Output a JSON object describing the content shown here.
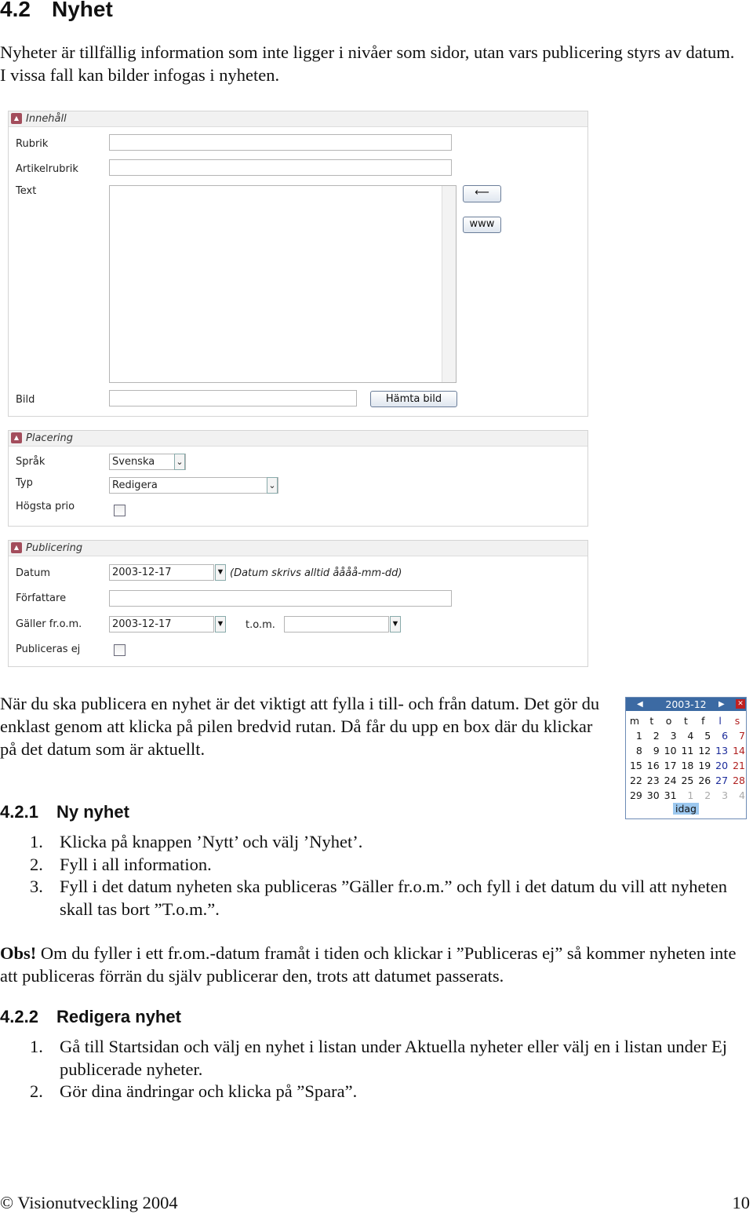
{
  "heading": {
    "number": "4.2",
    "title": "Nyhet"
  },
  "intro": "Nyheter är tillfällig information som inte ligger i nivåer som sidor, utan vars publicering styrs av datum. I vissa fall kan bilder infogas i nyheten.",
  "form": {
    "innehall": {
      "title": "Innehåll",
      "rubrik": "Rubrik",
      "artikelrubrik": "Artikelrubrik",
      "text": "Text",
      "bild": "Bild",
      "hamta_bild": "Hämta bild",
      "www": "www"
    },
    "placering": {
      "title": "Placering",
      "sprak": "Språk",
      "sprak_value": "Svenska",
      "typ": "Typ",
      "typ_value": "Redigera",
      "hogsta_prio": "Högsta prio"
    },
    "publicering": {
      "title": "Publicering",
      "datum": "Datum",
      "datum_value": "2003-12-17",
      "datum_hint": "(Datum skrivs alltid åååå-mm-dd)",
      "forfattare": "Författare",
      "galler": "Gäller fr.o.m.",
      "galler_value": "2003-12-17",
      "tom": "t.o.m.",
      "publiceras_ej": "Publiceras ej"
    }
  },
  "para2": "När du ska publicera en nyhet är det viktigt att fylla i till- och från datum. Det gör du enklast genom att klicka på pilen bredvid rutan. Då får du upp en box där du klickar på det datum som är aktuellt.",
  "calendar": {
    "month": "2003-12",
    "days": [
      "m",
      "t",
      "o",
      "t",
      "f",
      "l",
      "s"
    ],
    "weeks": [
      [
        "1",
        "2",
        "3",
        "4",
        "5",
        "6",
        "7"
      ],
      [
        "8",
        "9",
        "10",
        "11",
        "12",
        "13",
        "14"
      ],
      [
        "15",
        "16",
        "17",
        "18",
        "19",
        "20",
        "21"
      ],
      [
        "22",
        "23",
        "24",
        "25",
        "26",
        "27",
        "28"
      ],
      [
        "29",
        "30",
        "31",
        "1",
        "2",
        "3",
        "4"
      ]
    ],
    "today": "idag",
    "colors": {
      "header": "#3c6aa3",
      "saturday": "#1a2a9a",
      "sunday": "#b02020",
      "other_month": "#aaaaaa"
    }
  },
  "s421": {
    "number": "4.2.1",
    "title": "Ny nyhet",
    "items": [
      "Klicka på knappen ’Nytt’ och välj ’Nyhet’.",
      "Fyll i all information.",
      "Fyll i det datum nyheten ska publiceras ”Gäller fr.o.m.” och fyll i det datum du vill att nyheten skall tas bort ”T.o.m.”."
    ]
  },
  "obs": {
    "label": "Obs!",
    "text": " Om du fyller i ett fr.om.-datum framåt i tiden och klickar i ”Publiceras ej” så kommer nyheten inte att publiceras förrän du själv publicerar den, trots att datumet passerats."
  },
  "s422": {
    "number": "4.2.2",
    "title": "Redigera nyhet",
    "items": [
      "Gå till Startsidan och välj en nyhet i listan under Aktuella nyheter eller välj en i listan under Ej publicerade nyheter.",
      "Gör dina ändringar och klicka på ”Spara”."
    ]
  },
  "footer": {
    "left": "© Visionutveckling 2004",
    "page": "10"
  }
}
